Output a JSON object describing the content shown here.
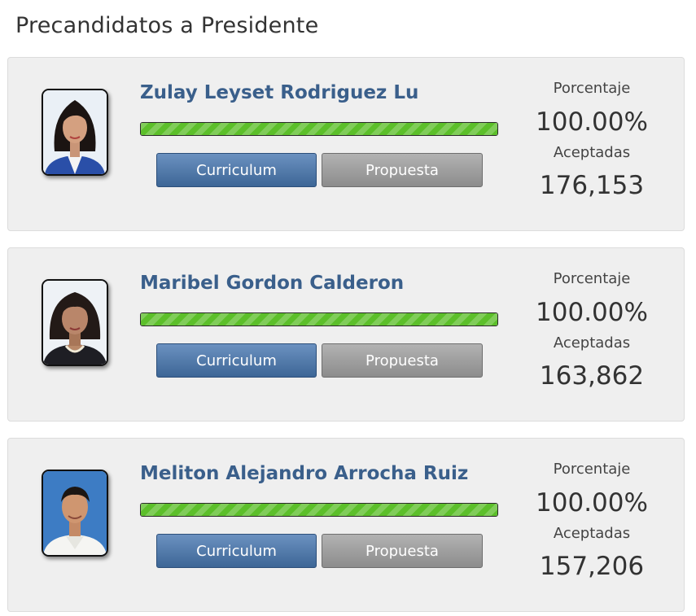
{
  "page": {
    "title": "Precandidatos a Presidente"
  },
  "labels": {
    "percentage": "Porcentaje",
    "accepted": "Aceptadas"
  },
  "buttons": {
    "curriculum": "Curriculum",
    "proposal": "Propuesta"
  },
  "colors": {
    "name": "#3a5f8b",
    "progress": "#5cbf2a",
    "curriculum_button": "#4a73a3",
    "proposal_button": "#9e9e9e"
  },
  "candidates": [
    {
      "name": "Zulay Leyset Rodriguez Lu",
      "progress_fraction": 1.0,
      "percentage": "100.00%",
      "accepted": "176,153"
    },
    {
      "name": "Maribel Gordon Calderon",
      "progress_fraction": 1.0,
      "percentage": "100.00%",
      "accepted": "163,862"
    },
    {
      "name": "Meliton Alejandro Arrocha Ruiz",
      "progress_fraction": 1.0,
      "percentage": "100.00%",
      "accepted": "157,206"
    }
  ]
}
